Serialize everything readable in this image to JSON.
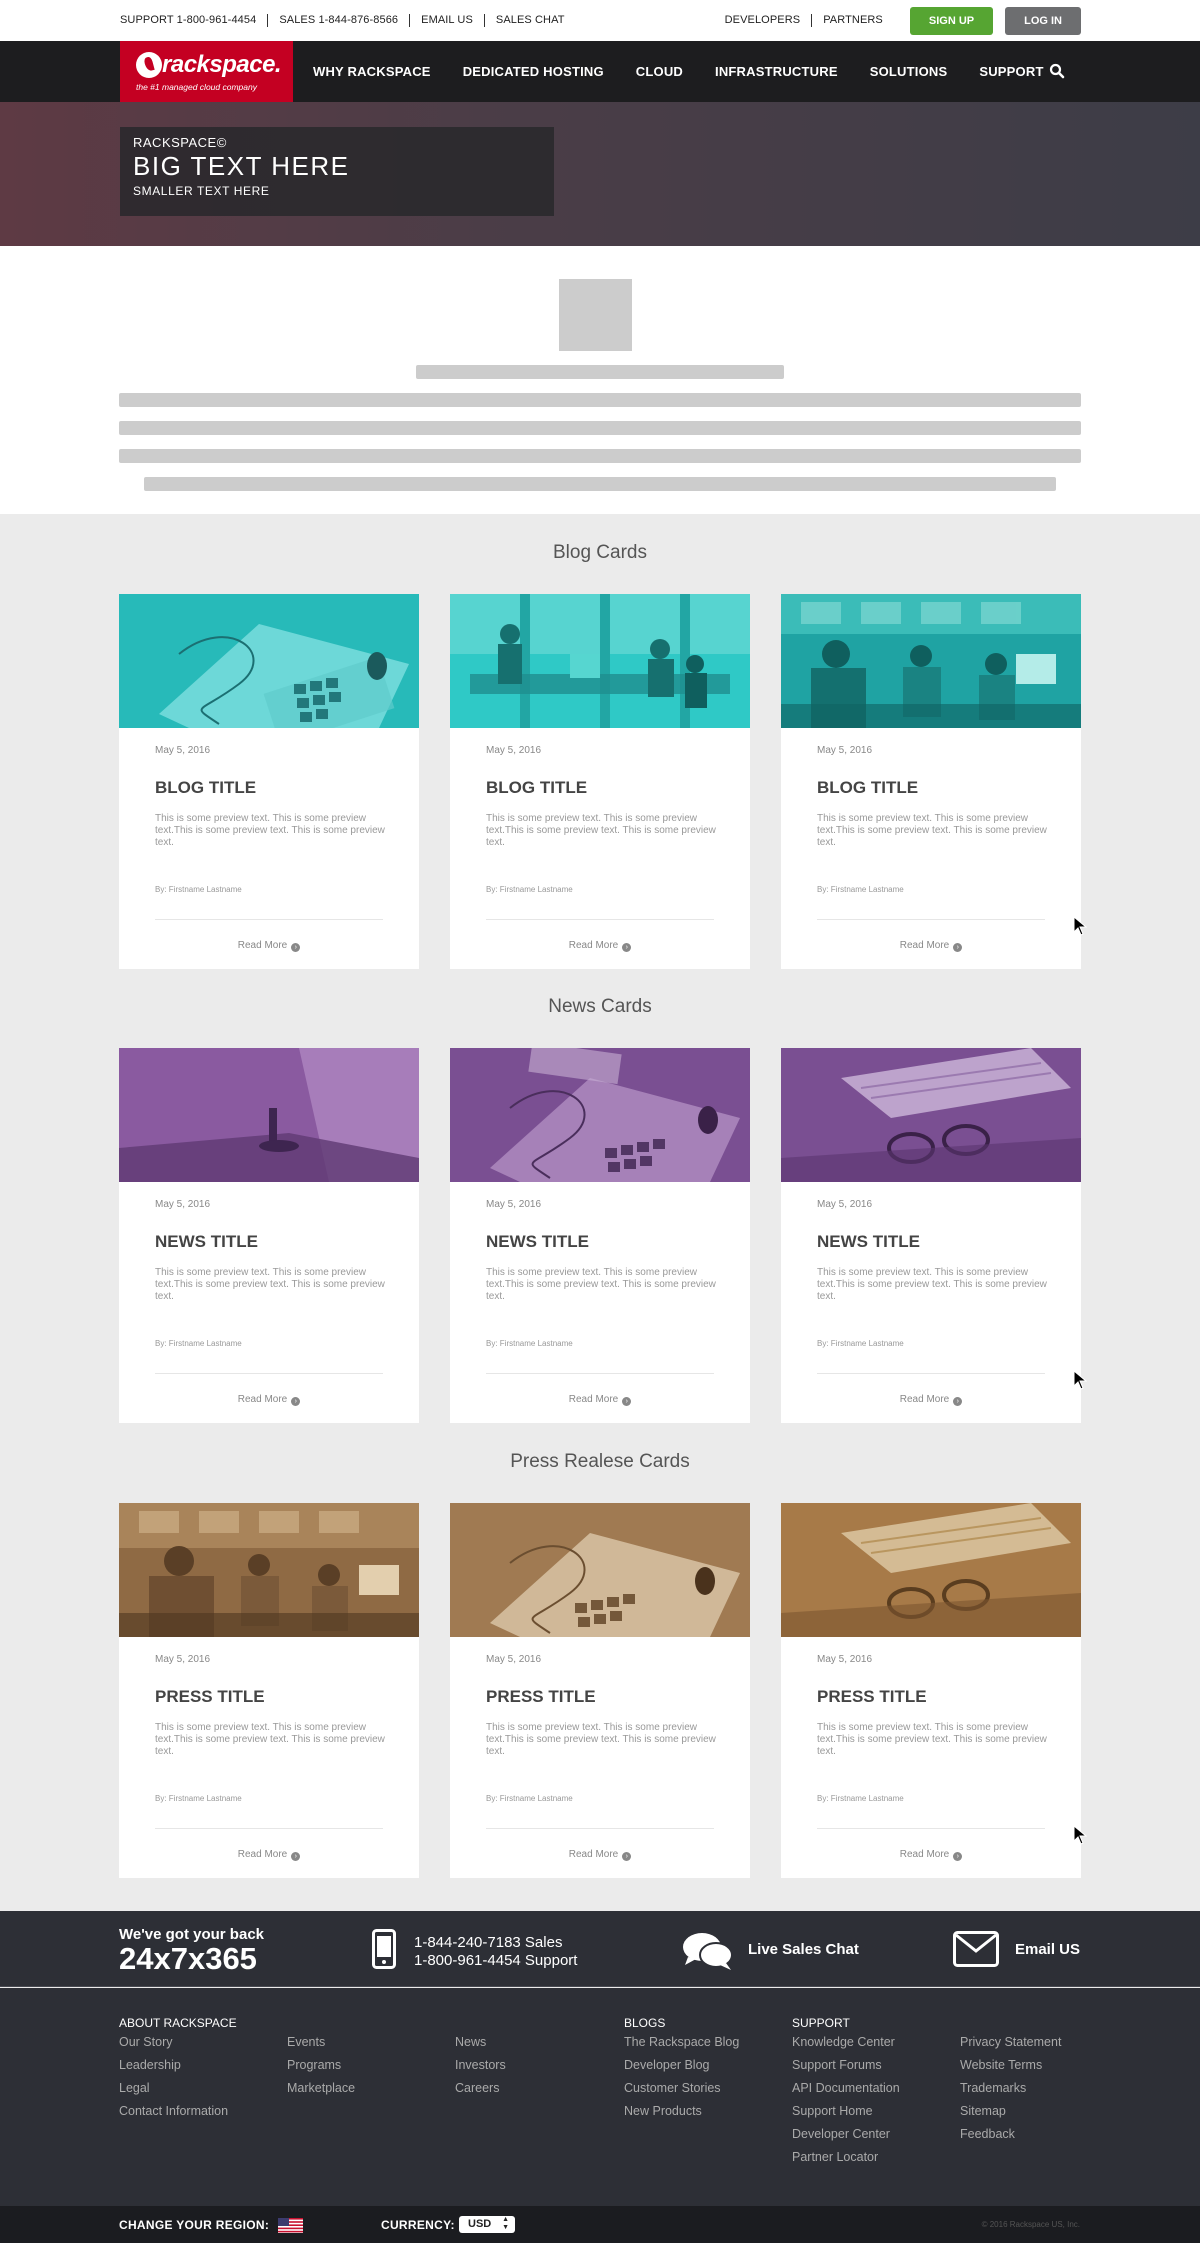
{
  "utility": {
    "left_links": [
      "SUPPORT 1-800-961-4454",
      "SALES 1-844-876-8566",
      "EMAIL US",
      "SALES CHAT"
    ],
    "right_links": [
      "DEVELOPERS",
      "PARTNERS"
    ],
    "signup": "SIGN UP",
    "login": "LOG IN",
    "signup_color": "#56a532",
    "login_color": "#6d6e70"
  },
  "nav": {
    "logo_word": "rackspace.",
    "logo_tagline": "the #1 managed cloud company",
    "brand_color": "#c40022",
    "items": [
      "WHY RACKSPACE",
      "DEDICATED HOSTING",
      "CLOUD",
      "INFRASTRUCTURE",
      "SOLUTIONS",
      "SUPPORT"
    ],
    "search_icon": "search-icon"
  },
  "hero": {
    "eyebrow": "RACKSPACE©",
    "big": "BIG TEXT HERE",
    "small": "SMALLER TEXT HERE"
  },
  "sections": [
    {
      "title": "Blog Cards",
      "tint": "#2fc9c6",
      "cards": [
        {
          "date": "May 5, 2016",
          "title": "BLOG TITLE",
          "text": "This is some preview text. This is some preview text.This is some preview text. This is some preview text.",
          "by": "By: Firstname Lastname",
          "more": "Read More"
        },
        {
          "date": "May 5, 2016",
          "title": "BLOG TITLE",
          "text": "This is some preview text. This is some preview text.This is some preview text. This is some preview text.",
          "by": "By: Firstname Lastname",
          "more": "Read More"
        },
        {
          "date": "May 5, 2016",
          "title": "BLOG TITLE",
          "text": "This is some preview text. This is some preview text.This is some preview text. This is some preview text.",
          "by": "By: Firstname Lastname",
          "more": "Read More"
        }
      ]
    },
    {
      "title": "News Cards",
      "tint": "#8a5aa0",
      "cards": [
        {
          "date": "May 5, 2016",
          "title": "NEWS TITLE",
          "text": "This is some preview text. This is some preview text.This is some preview text. This is some preview text.",
          "by": "By: Firstname Lastname",
          "more": "Read More"
        },
        {
          "date": "May 5, 2016",
          "title": "NEWS TITLE",
          "text": "This is some preview text. This is some preview text.This is some preview text. This is some preview text.",
          "by": "By: Firstname Lastname",
          "more": "Read More"
        },
        {
          "date": "May 5, 2016",
          "title": "NEWS TITLE",
          "text": "This is some preview text. This is some preview text.This is some preview text. This is some preview text.",
          "by": "By: Firstname Lastname",
          "more": "Read More"
        }
      ]
    },
    {
      "title": "Press Realese Cards",
      "tint": "#a77a48",
      "cards": [
        {
          "date": "May 5, 2016",
          "title": "PRESS TITLE",
          "text": "This is some preview text. This is some preview text.This is some preview text. This is some preview text.",
          "by": "By: Firstname Lastname",
          "more": "Read More"
        },
        {
          "date": "May 5, 2016",
          "title": "PRESS TITLE",
          "text": "This is some preview text. This is some preview text.This is some preview text. This is some preview text.",
          "by": "By: Firstname Lastname",
          "more": "Read More"
        },
        {
          "date": "May 5, 2016",
          "title": "PRESS TITLE",
          "text": "This is some preview text. This is some preview text.This is some preview text. This is some preview text.",
          "by": "By: Firstname Lastname",
          "more": "Read More"
        }
      ]
    }
  ],
  "contact": {
    "back_line1": "We've got your back",
    "back_line2": "24x7x365",
    "phone_sales": "1-844-240-7183 Sales",
    "phone_support": "1-800-961-4454 Support",
    "chat": "Live Sales Chat",
    "email": "Email US"
  },
  "footer": {
    "col1": {
      "head": "ABOUT RACKSPACE",
      "links": [
        "Our Story",
        "Leadership",
        "Legal",
        "Contact Information"
      ]
    },
    "col2": {
      "head": "",
      "links": [
        "Events",
        "Programs",
        "Marketplace"
      ]
    },
    "col3": {
      "head": "",
      "links": [
        "News",
        "Investors",
        "Careers"
      ]
    },
    "col4": {
      "head": "BLOGS",
      "links": [
        "The Rackspace Blog",
        "Developer Blog",
        "Customer Stories",
        "New Products"
      ]
    },
    "col5": {
      "head": "SUPPORT",
      "links": [
        "Knowledge Center",
        "Support Forums",
        "API Documentation",
        "Support Home",
        "Developer Center",
        "Partner Locator"
      ]
    },
    "col6": {
      "head": "",
      "links": [
        "Privacy Statement",
        "Website Terms",
        "Trademarks",
        "Sitemap",
        "Feedback"
      ]
    }
  },
  "bottom": {
    "region_label": "CHANGE YOUR REGION:",
    "currency_label": "CURRENCY:",
    "currency_value": "USD",
    "copyright": "© 2016 Rackspace US, Inc."
  }
}
